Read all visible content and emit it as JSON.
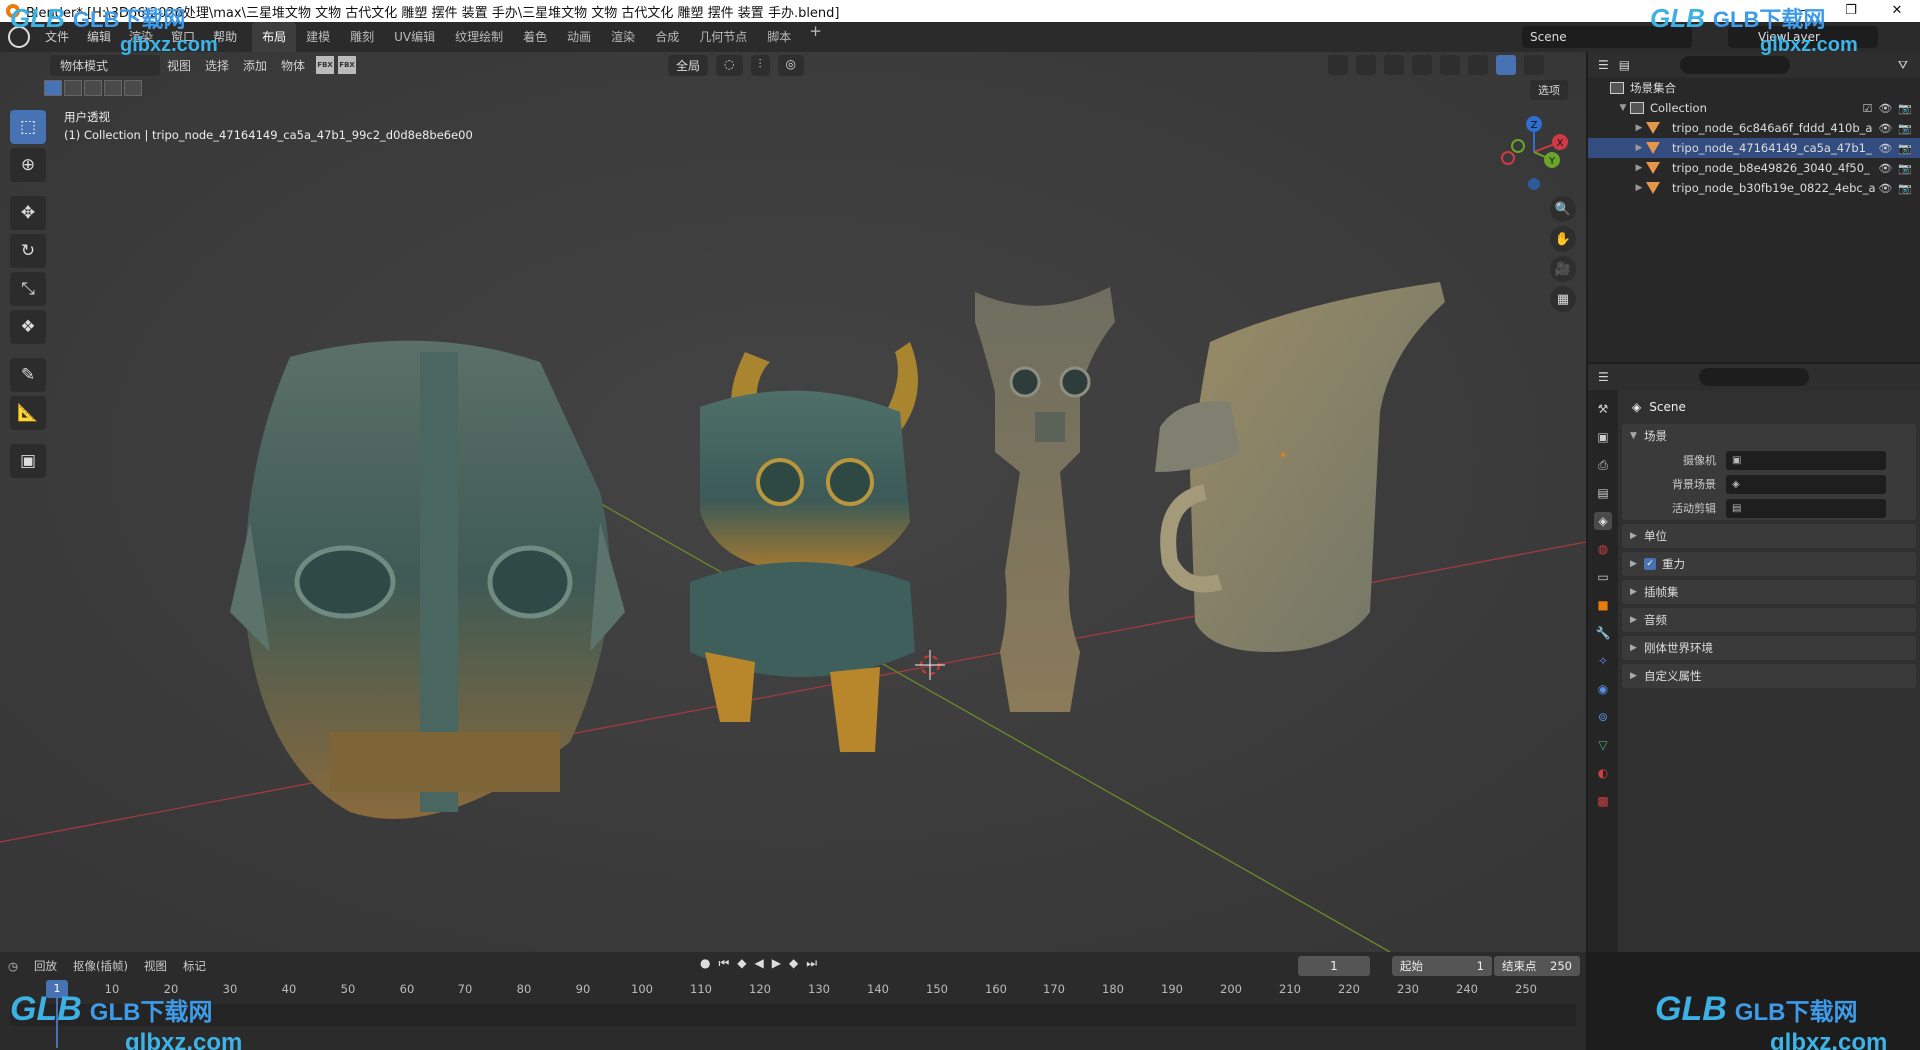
{
  "titlebar": {
    "text": "Blender* [H:\\3D66\\2026处理\\max\\三星堆文物 文物 古代文化 雕塑 摆件 装置 手办\\三星堆文物 文物 古代文化 雕塑 摆件 装置 手办.blend]",
    "minimize": "—",
    "maximize": "❐",
    "close": "✕"
  },
  "menubar": {
    "items": [
      "文件",
      "编辑",
      "渲染",
      "窗口",
      "帮助"
    ],
    "workspaces": [
      "布局",
      "建模",
      "雕刻",
      "UV编辑",
      "纹理绘制",
      "着色",
      "动画",
      "渲染",
      "合成",
      "几何节点",
      "脚本"
    ],
    "active_workspace": "布局",
    "add": "+",
    "scene": "Scene",
    "view_layer": "ViewLayer"
  },
  "viewport": {
    "mode": "物体模式",
    "menus": [
      "视图",
      "选择",
      "添加",
      "物体"
    ],
    "transform_orientation": "全局",
    "options": "选项",
    "view_name": "用户透视",
    "active_info": "(1) Collection | tripo_node_47164149_ca5a_47b1_99c2_d0d8e8be6e00",
    "gizmo": {
      "x": "X",
      "y": "Y",
      "z": "Z"
    },
    "accent": "#4772b3"
  },
  "outliner": {
    "root": "场景集合",
    "collection": "Collection",
    "objects": [
      "tripo_node_6c846a6f_fddd_410b_a",
      "tripo_node_47164149_ca5a_47b1_",
      "tripo_node_b8e49826_3040_4f50_",
      "tripo_node_b30fb19e_0822_4ebc_a"
    ]
  },
  "properties": {
    "scene_name": "Scene",
    "scene_panel": "场景",
    "camera_label": "摄像机",
    "bg_scene_label": "背景场景",
    "active_clip_label": "活动剪辑",
    "panels": [
      "单位",
      "重力",
      "插帧集",
      "音频",
      "刚体世界环境",
      "自定义属性"
    ]
  },
  "timeline": {
    "menus": [
      "回放",
      "抠像(插帧)",
      "视图",
      "标记"
    ],
    "current_frame": "1",
    "start_label": "起始",
    "start_value": "1",
    "end_label": "结束点",
    "end_value": "250",
    "ticks": [
      "10",
      "20",
      "30",
      "40",
      "50",
      "60",
      "70",
      "80",
      "90",
      "100",
      "110",
      "120",
      "130",
      "140",
      "150",
      "160",
      "170",
      "180",
      "190",
      "200",
      "210",
      "220",
      "230",
      "240",
      "250"
    ]
  },
  "watermark": {
    "cn": "GLB下载网",
    "url": "glbxz.com",
    "logo": "GLB"
  }
}
